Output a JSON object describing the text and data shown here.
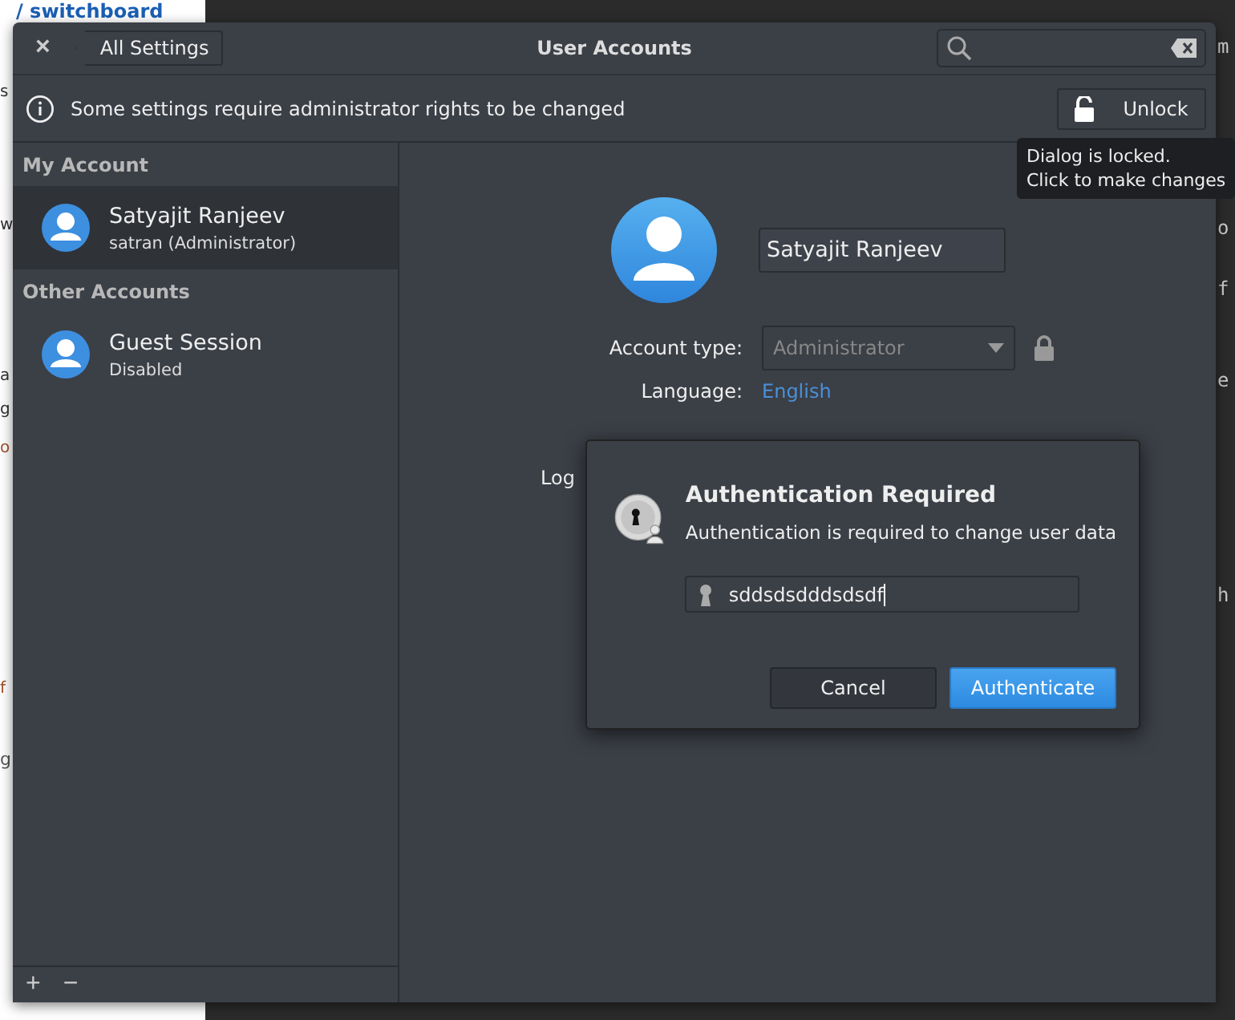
{
  "background_left": {
    "title": "/ switchboard",
    "fragments": [
      "s",
      "w",
      "a",
      "g",
      "o",
      "f",
      "g"
    ]
  },
  "background_right": {
    "fragments": [
      "m",
      "o",
      "f",
      "e",
      "h"
    ]
  },
  "window": {
    "title": "User Accounts",
    "back_button": "All Settings",
    "close": "×"
  },
  "infobar": {
    "message": "Some settings require administrator rights to be changed",
    "unlock_button": "Unlock"
  },
  "tooltip": {
    "lines": [
      "Dialog is locked.",
      "Click to make changes"
    ]
  },
  "sidebar": {
    "sections": [
      {
        "title": "My Account",
        "items": [
          {
            "name": "Satyajit Ranjeev",
            "detail": "satran  (Administrator)",
            "selected": true
          }
        ]
      },
      {
        "title": "Other Accounts",
        "items": [
          {
            "name": "Guest Session",
            "detail": "Disabled",
            "selected": false
          }
        ]
      }
    ],
    "add": "+",
    "remove": "−"
  },
  "account": {
    "full_name": "Satyajit Ranjeev",
    "account_type_label": "Account type:",
    "account_type": "Administrator",
    "account_type_disabled": true,
    "language_label": "Language:",
    "language": "English",
    "login_label": "Log"
  },
  "auth_dialog": {
    "title": "Authentication Required",
    "message": "Authentication is required to change user data",
    "password": "sddsdsdddsdsdf",
    "buttons": [
      {
        "label": "Cancel",
        "kind": "secondary"
      },
      {
        "label": "Authenticate",
        "kind": "primary"
      }
    ]
  }
}
